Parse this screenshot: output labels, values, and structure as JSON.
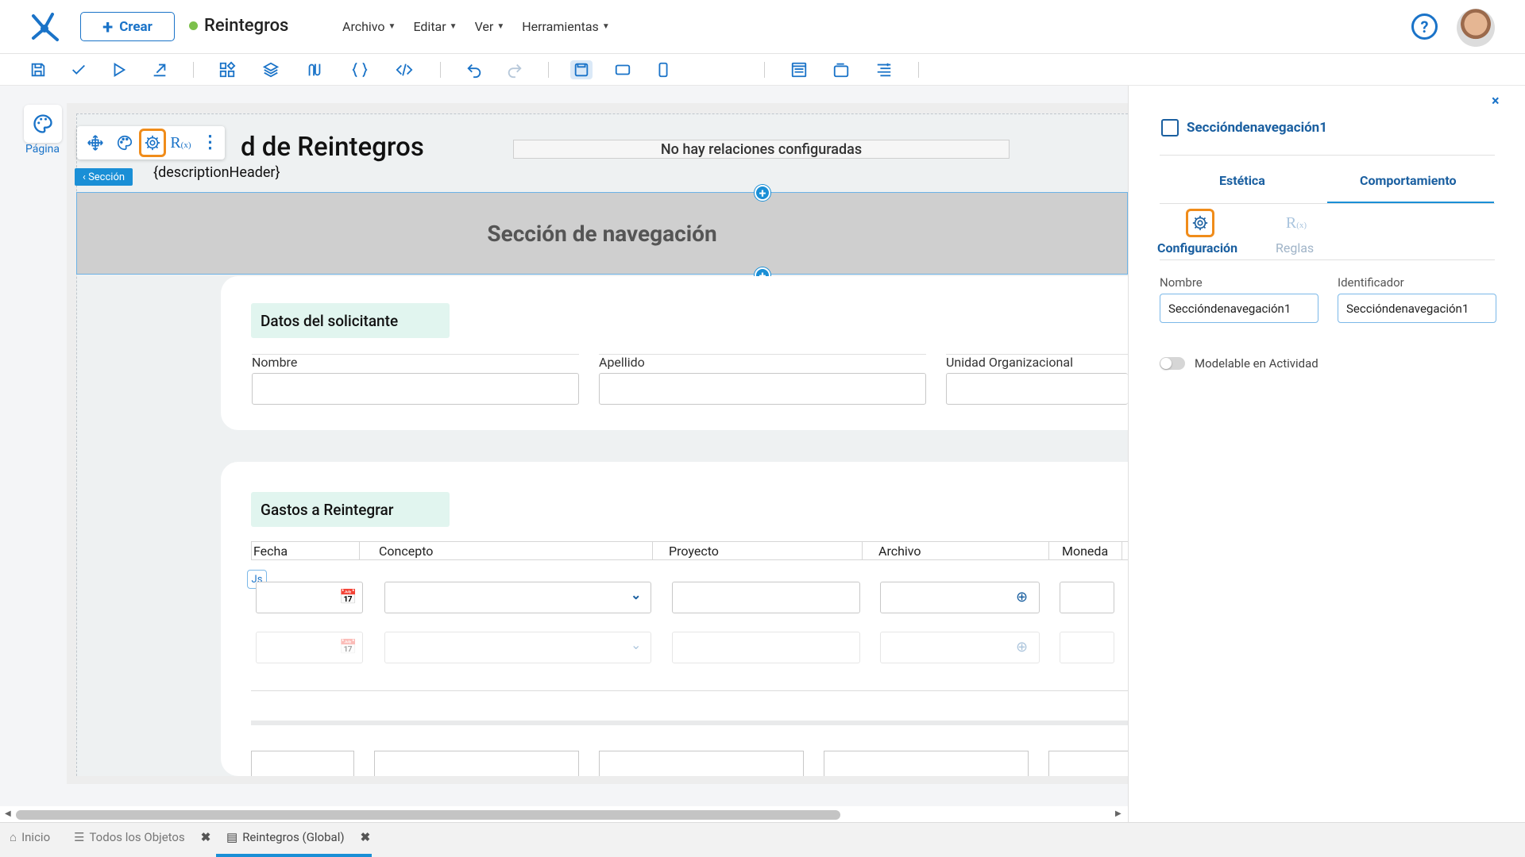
{
  "header": {
    "crear_label": "Crear",
    "app_title": "Reintegros",
    "menu": [
      "Archivo",
      "Editar",
      "Ver",
      "Herramientas"
    ],
    "help_symbol": "?"
  },
  "toolbar": {
    "width_label": "1382px"
  },
  "canvas": {
    "pagina_label": "Página",
    "header_title": "d de Reintegros",
    "description_header": "{descriptionHeader}",
    "relations_text": "No hay relaciones configuradas",
    "seccion_tag": "‹ Sección",
    "nav_section_title": "Sección de navegación",
    "card1": {
      "title": "Datos del solicitante",
      "fields": [
        "Nombre",
        "Apellido",
        "Unidad Organizacional"
      ]
    },
    "card2": {
      "title": "Gastos a Reintegrar",
      "columns": [
        "Fecha",
        "Concepto",
        "Proyecto",
        "Archivo",
        "Moneda"
      ]
    },
    "js_badge": "Js"
  },
  "panel": {
    "close_symbol": "×",
    "title": "Seccióndenavegación1",
    "tabs": [
      "Estética",
      "Comportamiento"
    ],
    "subtabs": [
      "Configuración",
      "Reglas"
    ],
    "fields": {
      "nombre_label": "Nombre",
      "nombre_value": "Seccióndenavegación1",
      "identificador_label": "Identificador",
      "identificador_value": "Seccióndenavegación1"
    },
    "toggle_label": "Modelable en Actividad"
  },
  "bottom_tabs": [
    {
      "label": "Inicio"
    },
    {
      "label": "Todos los Objetos"
    },
    {
      "label": "Reintegros (Global)"
    }
  ],
  "colors": {
    "accent": "#1a73c8",
    "selection_outline": "#f08c1a",
    "status_dot": "#7cc04b"
  }
}
